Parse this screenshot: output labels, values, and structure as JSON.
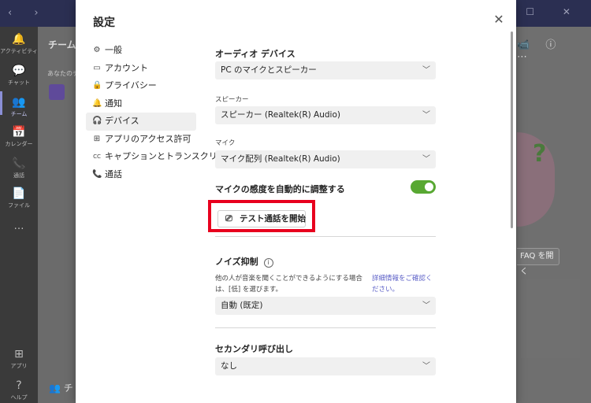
{
  "rail": {
    "items": [
      {
        "label": "アクティビティ",
        "icon": "bell-icon",
        "glyph": "🔔"
      },
      {
        "label": "チャット",
        "icon": "chat-icon",
        "glyph": "💬"
      },
      {
        "label": "チーム",
        "icon": "teams-icon",
        "glyph": "👥"
      },
      {
        "label": "カレンダー",
        "icon": "calendar-icon",
        "glyph": "📅"
      },
      {
        "label": "通話",
        "icon": "phone-icon",
        "glyph": "📞"
      },
      {
        "label": "ファイル",
        "icon": "file-icon",
        "glyph": "📄"
      },
      {
        "label": "…",
        "icon": "more-icon",
        "glyph": ""
      },
      {
        "label": "アプリ",
        "icon": "apps-icon",
        "glyph": "⊞"
      },
      {
        "label": "ヘルプ",
        "icon": "help-icon",
        "glyph": "?"
      }
    ]
  },
  "background": {
    "team_header": "チーム",
    "team_sub": "あなたのチ",
    "faq_button": "FAQ を開く",
    "bottom_text": "チ"
  },
  "dialog": {
    "title": "設定",
    "close_glyph": "✕",
    "menu": [
      {
        "label": "一般",
        "icon": "gear-icon",
        "glyph": "⚙"
      },
      {
        "label": "アカウント",
        "icon": "id-card-icon",
        "glyph": "▭"
      },
      {
        "label": "プライバシー",
        "icon": "lock-icon",
        "glyph": "🔒"
      },
      {
        "label": "通知",
        "icon": "bell-icon",
        "glyph": "🔔"
      },
      {
        "label": "デバイス",
        "icon": "devices-icon",
        "glyph": "🎧"
      },
      {
        "label": "アプリのアクセス許可",
        "icon": "apps-icon",
        "glyph": "⊞"
      },
      {
        "label": "キャプションとトランスクリプト",
        "icon": "cc-icon",
        "glyph": "CC"
      },
      {
        "label": "通話",
        "icon": "phone-icon",
        "glyph": "📞"
      }
    ],
    "active_menu_index": 4,
    "audio": {
      "section_title": "オーディオ デバイス",
      "audio_device_value": "PC のマイクとスピーカー",
      "speaker_label": "スピーカー",
      "speaker_value": "スピーカー (Realtek(R) Audio)",
      "mic_label": "マイク",
      "mic_value": "マイク配列 (Realtek(R) Audio)",
      "auto_adjust_label": "マイクの感度を自動的に調整する",
      "auto_adjust_on": true,
      "test_call_button": "テスト通話を開始"
    },
    "noise": {
      "section_title": "ノイズ抑制",
      "info_glyph": "i",
      "description": "他の人が音楽を聞くことができるようにする場合は、[低] を選びます。",
      "link": "詳細情報をご確認ください。",
      "value": "自動 (既定)"
    },
    "secondary": {
      "section_title": "セカンダリ呼び出し",
      "value": "なし"
    }
  }
}
